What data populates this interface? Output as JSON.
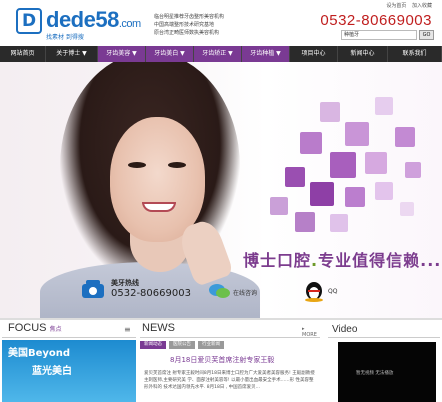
{
  "header": {
    "logo_mark": "D",
    "logo_word": "dede58",
    "logo_suffix": ".com",
    "logo_sub": "找素材 到得搜",
    "slogans": [
      "临台明星推荐牙齿整形美容机构",
      "中国高端整形技术研究基地",
      "原台湾正畸医师数执美容机构"
    ],
    "top_links": [
      "设为首页",
      "加入收藏"
    ],
    "phone": "0532-80669003",
    "search_value": "种植牙",
    "search_button": "GO"
  },
  "nav": {
    "items": [
      {
        "label": "网站首页",
        "style": "dark"
      },
      {
        "label": "关于博士 ▼",
        "style": "dark"
      },
      {
        "label": "牙齿美容 ▼",
        "style": "purple"
      },
      {
        "label": "牙齿美白 ▼",
        "style": "purple"
      },
      {
        "label": "牙齿矫正 ▼",
        "style": "purple"
      },
      {
        "label": "牙齿种植 ▼",
        "style": "purple"
      },
      {
        "label": "项目中心",
        "style": "dark"
      },
      {
        "label": "新闻中心",
        "style": "dark"
      },
      {
        "label": "联系我们",
        "style": "dark"
      }
    ]
  },
  "banner": {
    "tagline_a": "博士口腔",
    "tagline_b": "专业值得信赖",
    "tagline_dots": "...",
    "hotline_label": "美牙热线",
    "hotline_number": "0532-80669003",
    "online_label": "在线咨询",
    "qq_label": "QQ"
  },
  "focus": {
    "title": "FOCUS",
    "title_cn": "焦点",
    "menu_icon": "≡",
    "image_line1": "美国Beyond",
    "image_line2": "蓝光美白"
  },
  "news": {
    "title": "NEWS",
    "more": "▸ MORE",
    "tabs": [
      "新闻动态",
      "医院公告",
      "行业新闻"
    ],
    "headline": "8月18日爱贝芙首席注射专家王毅",
    "summary": "爱贝芙首席注 射专家王毅时间8月18日来博士口腔为广大爱美者美容服务! 王毅副教授主刺医师,主要研究美 学、面部注射美容等! 以最小量出血最安全手术……形 性美容整形外科的 技术达国内领先水平. 8月18日 , 中国首席爱贝..."
  },
  "video": {
    "title": "Video",
    "screen_text": "暂无视频 无法播放"
  },
  "colors": {
    "brand_blue": "#1c6fc0",
    "purple": "#7a3a93",
    "phone_red": "#c01e1e",
    "nav_bg": "#222222"
  }
}
